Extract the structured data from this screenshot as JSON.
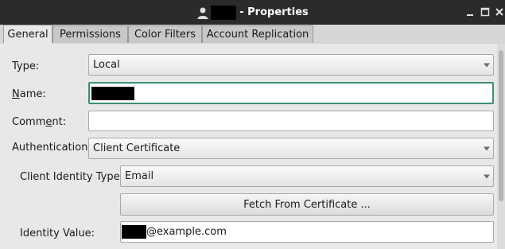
{
  "window": {
    "title": "- Properties",
    "icons": {
      "user": "user-icon",
      "minimize": "minimize-icon",
      "maximize": "maximize-icon",
      "close": "close-icon"
    }
  },
  "tabs": [
    {
      "label": "General",
      "active": true
    },
    {
      "label": "Permissions",
      "active": false
    },
    {
      "label": "Color Filters",
      "active": false
    },
    {
      "label": "Account Replication",
      "active": false
    }
  ],
  "form": {
    "type_label": "Type:",
    "type_value": "Local",
    "name_label_prefix": "N",
    "name_label_rest": "ame:",
    "name_value": "",
    "comment_label_prefix": "Comm",
    "comment_label_underlined": "e",
    "comment_label_rest": "nt:",
    "comment_value": "",
    "auth_label": "Authentication:",
    "auth_value": "Client Certificate",
    "client_identity_label": "Client Identity Type:",
    "client_identity_value": "Email",
    "fetch_button": "Fetch From Certificate ...",
    "identity_value_label": "Identity Value:",
    "identity_value_suffix": "@example.com"
  },
  "colors": {
    "focus_border": "#3a8f77",
    "titlebar_bg": "#2b2b2b"
  }
}
